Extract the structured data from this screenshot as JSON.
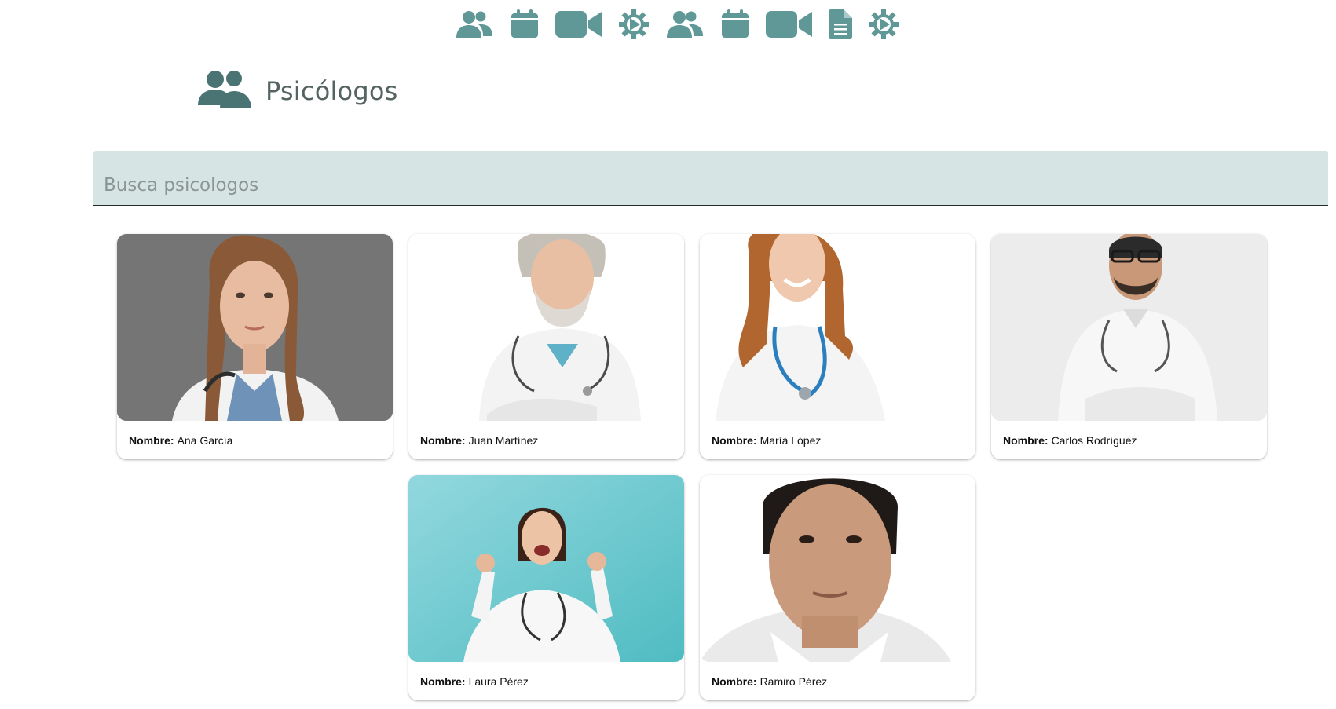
{
  "nav": {
    "icons": [
      "users-icon",
      "calendar-icon",
      "video-icon",
      "settings-icon",
      "users-icon",
      "calendar-icon",
      "video-icon",
      "document-icon",
      "settings-icon"
    ],
    "color": "#5f9896"
  },
  "header": {
    "title": "Psicólogos",
    "icon": "users-icon",
    "icon_color": "#4a7473"
  },
  "search": {
    "placeholder": "Busca psicologos",
    "background": "#d6e4e3"
  },
  "cards": [
    {
      "label": "Nombre:",
      "name": "Ana García",
      "photo_bg": "#7a7a7a"
    },
    {
      "label": "Nombre:",
      "name": "Juan Martínez",
      "photo_bg": "#ffffff"
    },
    {
      "label": "Nombre:",
      "name": "María López",
      "photo_bg": "#ffffff"
    },
    {
      "label": "Nombre:",
      "name": "Carlos Rodríguez",
      "photo_bg": "#eeeeee"
    },
    {
      "label": "Nombre:",
      "name": "Laura Pérez",
      "photo_bg": "#6fcfd3"
    },
    {
      "label": "Nombre:",
      "name": "Ramiro Pérez",
      "photo_bg": "#ffffff"
    }
  ]
}
